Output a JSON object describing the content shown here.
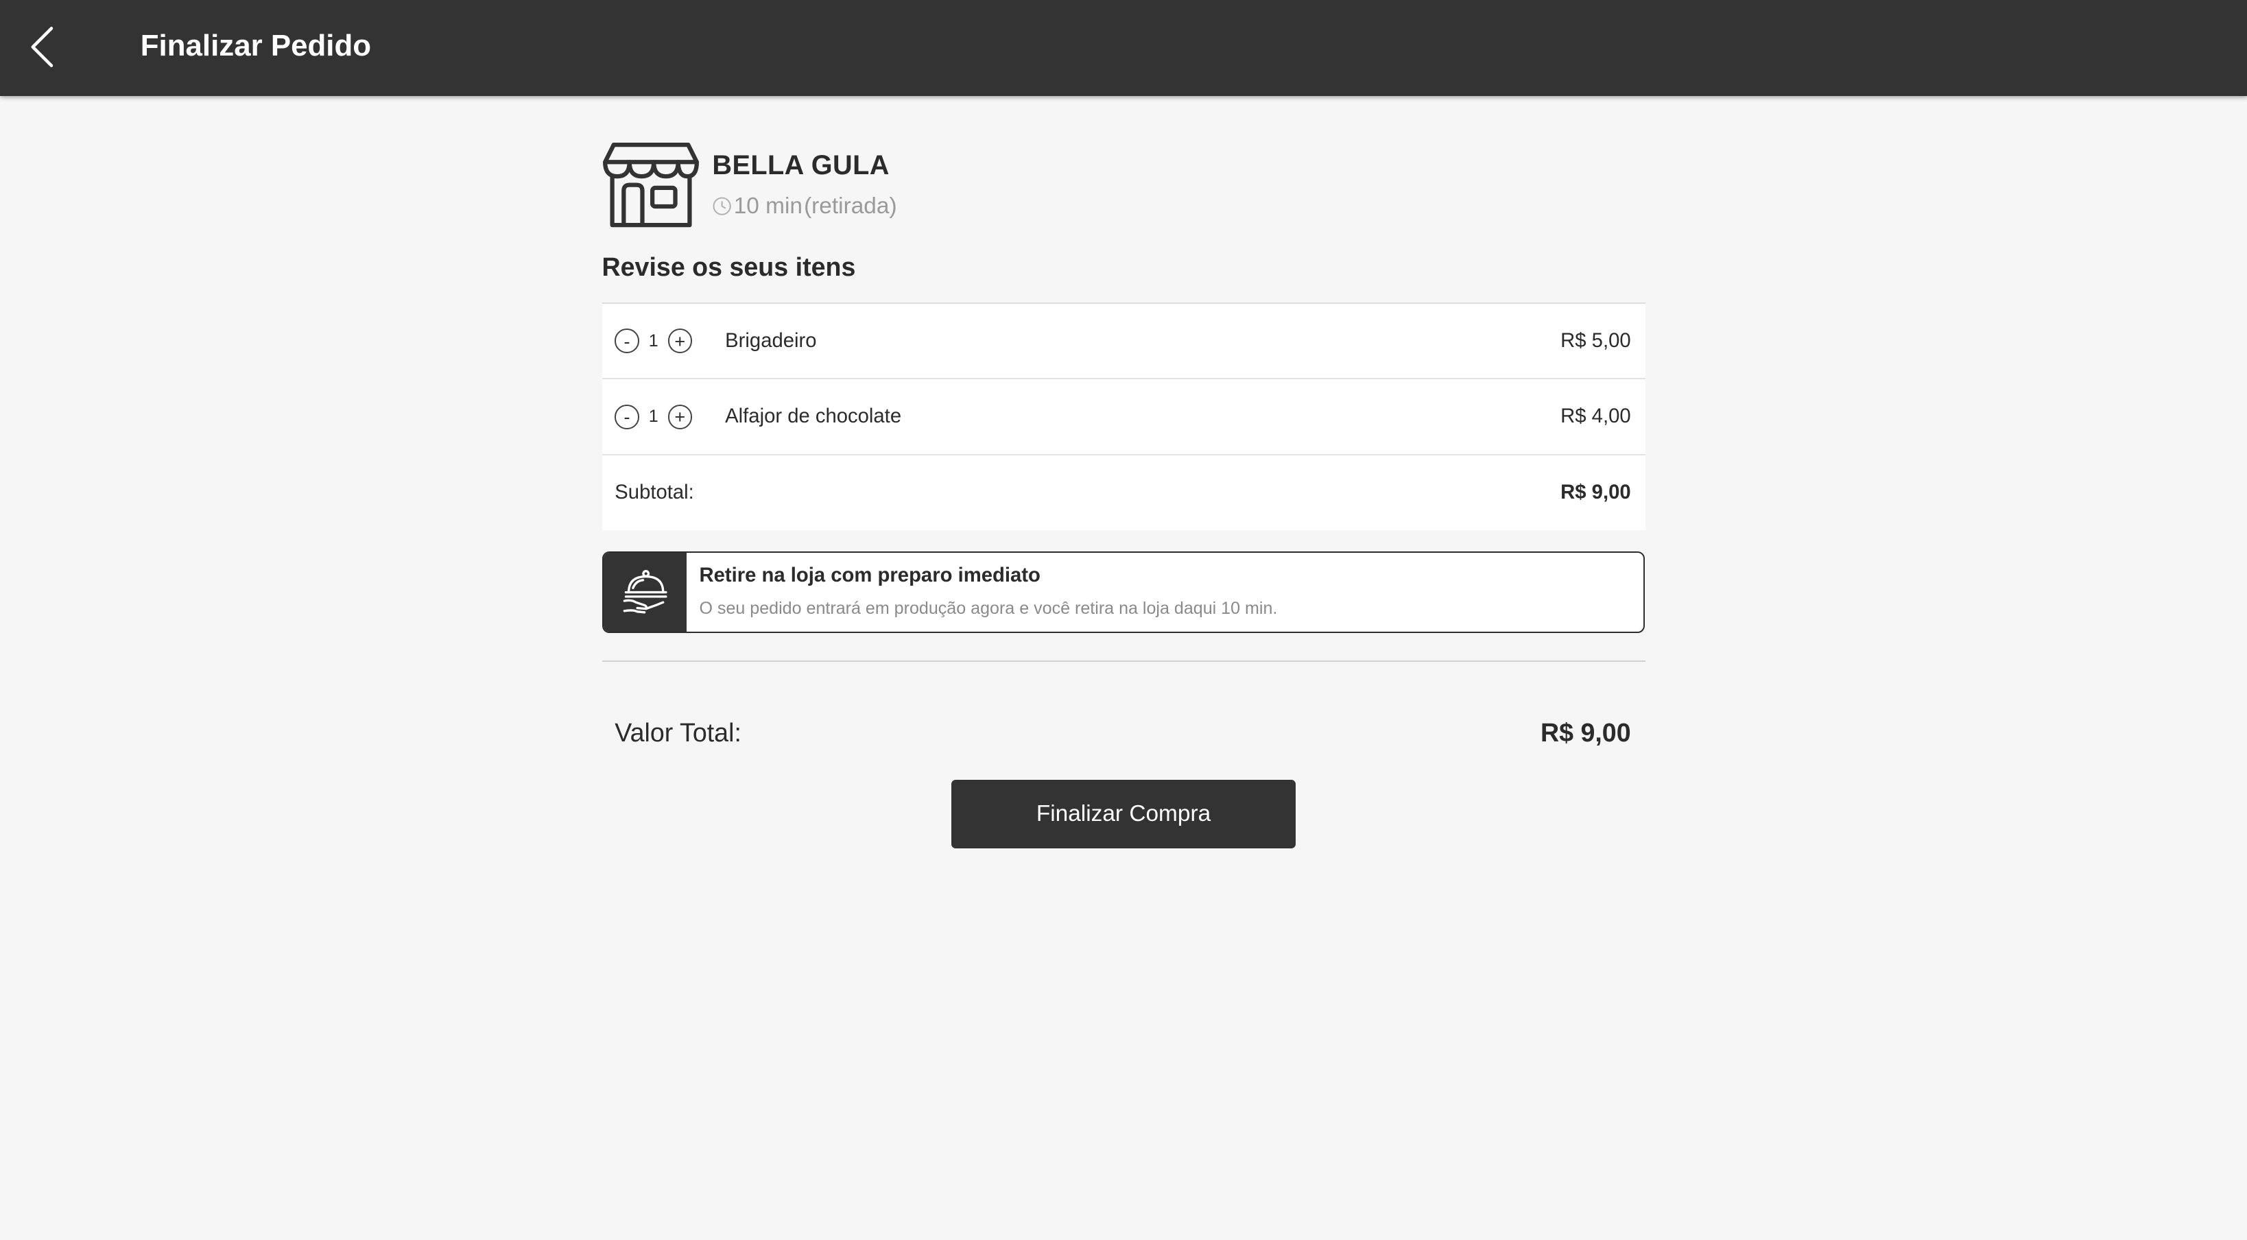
{
  "header": {
    "title": "Finalizar Pedido",
    "back_icon": "chevron-left-icon"
  },
  "store": {
    "name": "BELLA GULA",
    "icon": "storefront-icon",
    "time_icon": "clock-icon",
    "time": "10 min",
    "mode": "(retirada)"
  },
  "review_title": "Revise os seus itens",
  "items": [
    {
      "qty_minus": "-",
      "qty": "1",
      "qty_plus": "+",
      "name": "Brigadeiro",
      "price": "R$ 5,00"
    },
    {
      "qty_minus": "-",
      "qty": "1",
      "qty_plus": "+",
      "name": "Alfajor de chocolate",
      "price": "R$ 4,00"
    }
  ],
  "subtotal": {
    "label": "Subtotal:",
    "value": "R$ 9,00"
  },
  "pickup": {
    "icon": "serving-cloche-icon",
    "title": "Retire na loja com preparo imediato",
    "description": "O seu pedido entrará em produção agora e você retira na loja daqui 10 min."
  },
  "total": {
    "label": "Valor Total:",
    "value": "R$ 9,00"
  },
  "finish_button": "Finalizar Compra",
  "colors": {
    "header_bg": "#333333",
    "page_bg": "#f6f6f6",
    "button_bg": "#333333"
  }
}
